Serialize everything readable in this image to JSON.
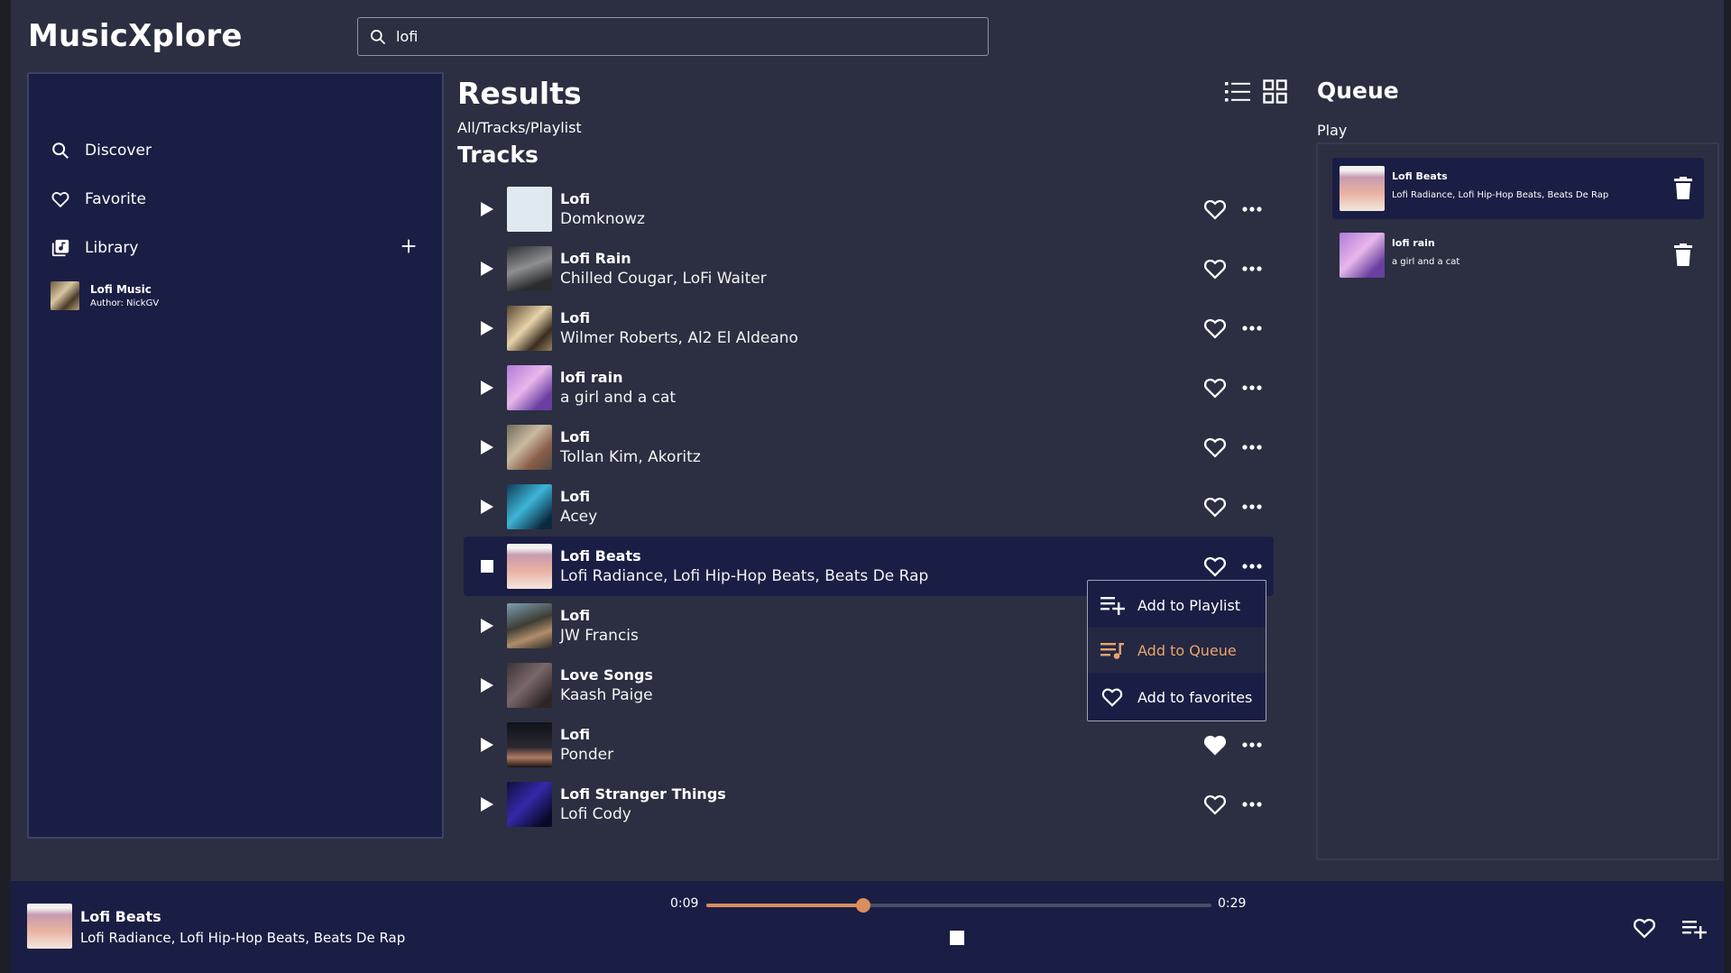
{
  "app": {
    "name": "MusicXplore"
  },
  "search": {
    "value": "lofi",
    "icon": "search-icon"
  },
  "sidebar": {
    "items": [
      {
        "label": "Discover",
        "icon": "search-icon"
      },
      {
        "label": "Favorite",
        "icon": "heart-icon"
      },
      {
        "label": "Library",
        "icon": "library-icon"
      }
    ],
    "playlists": [
      {
        "title": "Lofi Music",
        "author": "Author: NickGV"
      }
    ]
  },
  "results": {
    "title": "Results",
    "breadcrumb": "All/Tracks/Playlist",
    "section": "Tracks",
    "view_modes": [
      "list-view-icon",
      "grid-view-icon"
    ],
    "tracks": [
      {
        "title": "Lofi",
        "artist": "Domknowz",
        "favorited": false,
        "playing": false
      },
      {
        "title": "Lofi Rain",
        "artist": "Chilled Cougar, LoFi Waiter",
        "favorited": false,
        "playing": false
      },
      {
        "title": "Lofi",
        "artist": "Wilmer Roberts, Al2 El Aldeano",
        "favorited": false,
        "playing": false
      },
      {
        "title": "lofi rain",
        "artist": "a girl and a cat",
        "favorited": false,
        "playing": false
      },
      {
        "title": "Lofi",
        "artist": "Tollan Kim, Akoritz",
        "favorited": false,
        "playing": false
      },
      {
        "title": "Lofi",
        "artist": "Acey",
        "favorited": false,
        "playing": false
      },
      {
        "title": "Lofi Beats",
        "artist": "Lofi Radiance, Lofi Hip-Hop Beats, Beats De Rap",
        "favorited": false,
        "playing": true
      },
      {
        "title": "Lofi",
        "artist": "JW Francis",
        "favorited": false,
        "playing": false
      },
      {
        "title": "Love Songs",
        "artist": "Kaash Paige",
        "favorited": false,
        "playing": false
      },
      {
        "title": "Lofi",
        "artist": "Ponder",
        "favorited": true,
        "playing": false
      },
      {
        "title": "Lofi Stranger Things",
        "artist": "Lofi Cody",
        "favorited": false,
        "playing": false
      }
    ]
  },
  "context_menu": {
    "items": [
      {
        "label": "Add to Playlist",
        "icon": "playlist-add-icon"
      },
      {
        "label": "Add to Queue",
        "icon": "queue-music-icon",
        "highlighted": true
      },
      {
        "label": "Add to favorites",
        "icon": "heart-icon"
      }
    ]
  },
  "queue": {
    "title": "Queue",
    "subtitle": "Play",
    "items": [
      {
        "title": "Lofi Beats",
        "artist": "Lofi Radiance, Lofi Hip-Hop Beats, Beats De Rap",
        "active": true
      },
      {
        "title": "lofi rain",
        "artist": "a girl and a cat",
        "active": false
      }
    ]
  },
  "player": {
    "title": "Lofi Beats",
    "artist": "Lofi Radiance, Lofi Hip-Hop Beats, Beats De Rap",
    "current_time": "0:09",
    "total_time": "0:29",
    "progress_fraction": 0.31
  },
  "colors": {
    "background": "#2b2f41",
    "panel": "#1b1e44",
    "accent": "#d98e5e",
    "highlight_text": "#e9a46d"
  }
}
